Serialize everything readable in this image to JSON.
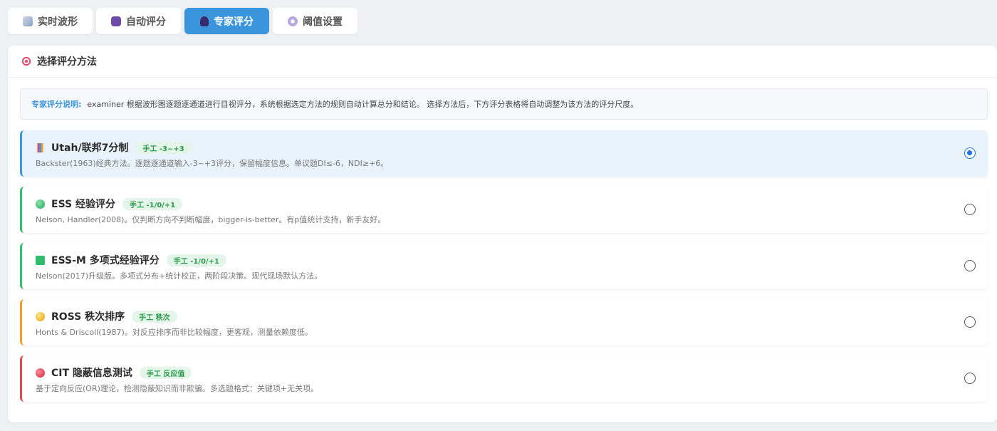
{
  "tabs": [
    {
      "label": "实时波形",
      "icon": "waveform-icon"
    },
    {
      "label": "自动评分",
      "icon": "robot-icon"
    },
    {
      "label": "专家评分",
      "icon": "user-icon"
    },
    {
      "label": "阈值设置",
      "icon": "gear-icon"
    }
  ],
  "active_tab": "专家评分",
  "section": {
    "title": "选择评分方法",
    "icon": "target-icon"
  },
  "note": {
    "lead": "专家评分说明:",
    "text": "examiner 根据波形图逐题逐通道进行目视评分，系统根据选定方法的规则自动计算总分和结论。 选择方法后，下方评分表格将自动调整为该方法的评分尺度。"
  },
  "methods": [
    {
      "name": "Utah/联邦7分制",
      "badge": "手工 -3~+3",
      "desc": "Backster(1963)经典方法。逐题逐通道输入-3~+3评分，保留幅度信息。单议题DI≤-6，NDI≥+6。",
      "icon": "bar-chart-icon",
      "accent": "#3a95dc",
      "selected": true
    },
    {
      "name": "ESS 经验评分",
      "badge": "手工 -1/0/+1",
      "desc": "Nelson, Handler(2008)。仅判断方向不判断幅度，bigger-is-better。有p值统计支持，新手友好。",
      "icon": "green-circle-icon",
      "accent": "#2ebd6b",
      "selected": false
    },
    {
      "name": "ESS-M 多项式经验评分",
      "badge": "手工 -1/0/+1",
      "desc": "Nelson(2017)升级版。多项式分布+统计校正，两阶段决策。现代现场默认方法。",
      "icon": "green-square-icon",
      "accent": "#2ebd6b",
      "selected": false
    },
    {
      "name": "ROSS 秩次排序",
      "badge": "手工 秩次",
      "desc": "Honts & Driscoll(1987)。对反应排序而非比较幅度，更客观，测量依赖度低。",
      "icon": "yellow-circle-icon",
      "accent": "#f0a020",
      "selected": false
    },
    {
      "name": "CIT 隐蔽信息测试",
      "badge": "手工 反应值",
      "desc": "基于定向反应(OR)理论，检测隐蔽知识而非欺骗。多选题格式：关键项+无关项。",
      "icon": "red-circle-icon",
      "accent": "#e5484d",
      "selected": false
    }
  ]
}
